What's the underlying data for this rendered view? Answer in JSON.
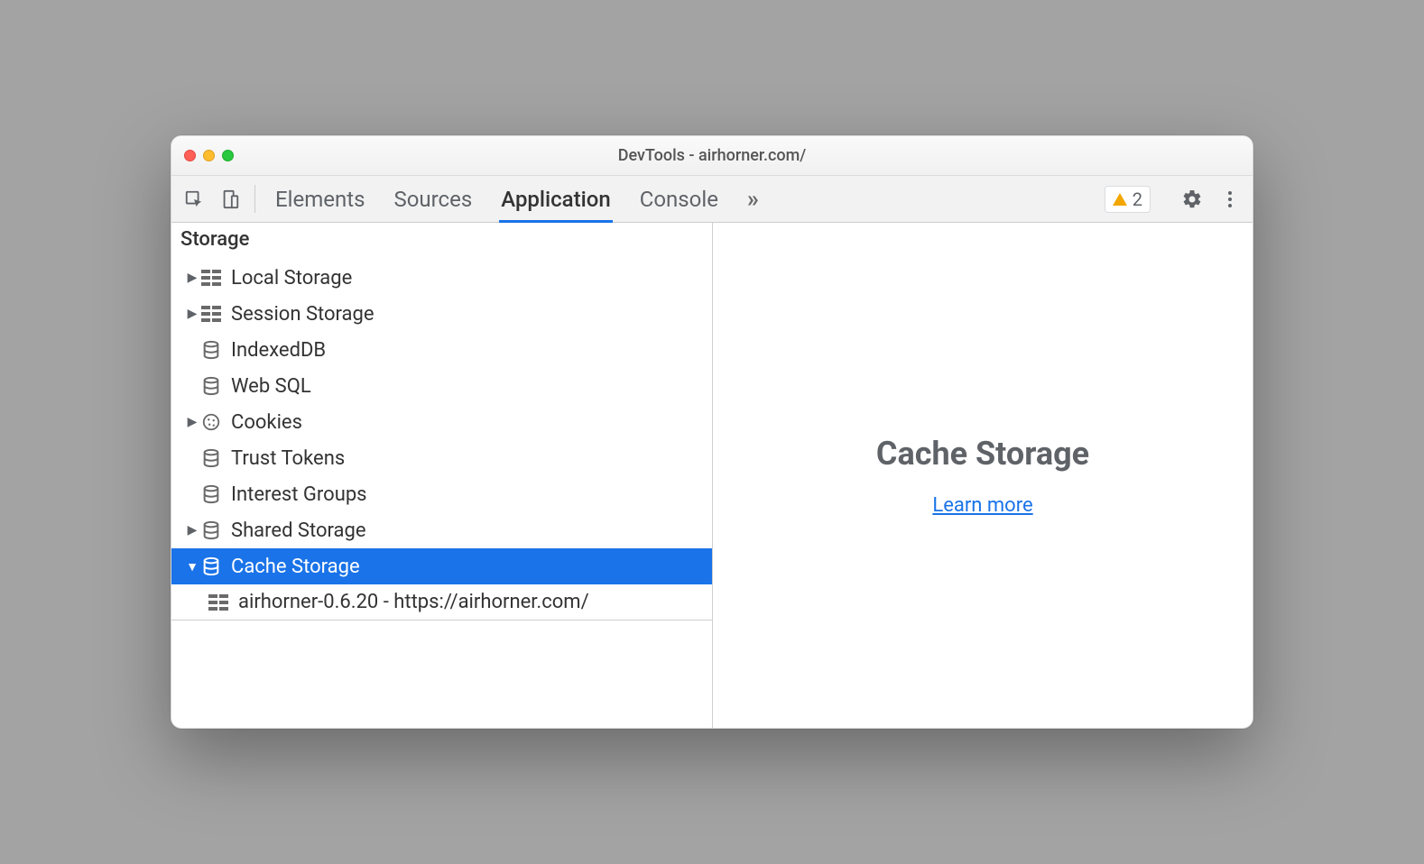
{
  "window": {
    "title": "DevTools - airhorner.com/"
  },
  "toolbar": {
    "tabs": [
      "Elements",
      "Sources",
      "Application",
      "Console"
    ],
    "active_tab_index": 2,
    "issues_count": "2"
  },
  "sidebar": {
    "section_header": "Storage",
    "items": [
      {
        "label": "Local Storage",
        "icon": "grid",
        "expandable": true,
        "expanded": false
      },
      {
        "label": "Session Storage",
        "icon": "grid",
        "expandable": true,
        "expanded": false
      },
      {
        "label": "IndexedDB",
        "icon": "db",
        "expandable": false
      },
      {
        "label": "Web SQL",
        "icon": "db",
        "expandable": false
      },
      {
        "label": "Cookies",
        "icon": "cookie",
        "expandable": true,
        "expanded": false
      },
      {
        "label": "Trust Tokens",
        "icon": "db",
        "expandable": false
      },
      {
        "label": "Interest Groups",
        "icon": "db",
        "expandable": false
      },
      {
        "label": "Shared Storage",
        "icon": "db",
        "expandable": true,
        "expanded": false
      },
      {
        "label": "Cache Storage",
        "icon": "db",
        "expandable": true,
        "expanded": true,
        "selected": true
      },
      {
        "label": "airhorner-0.6.20 - https://airhorner.com/",
        "icon": "grid",
        "child": true
      }
    ]
  },
  "main": {
    "heading": "Cache Storage",
    "link_label": "Learn more"
  }
}
